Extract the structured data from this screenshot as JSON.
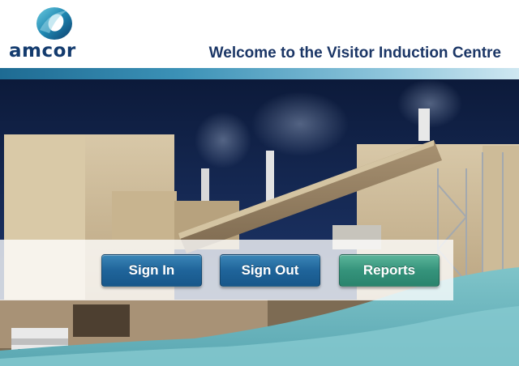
{
  "header": {
    "brand": "amcor",
    "welcome_text": "Welcome to the Visitor Induction Centre"
  },
  "actions": {
    "sign_in": "Sign In",
    "sign_out": "Sign Out",
    "reports": "Reports"
  },
  "colors": {
    "brand_navy": "#1b3666",
    "button_blue": "#1f649a",
    "button_green": "#35937b"
  },
  "icons": {
    "logo": "amcor-logo-icon"
  }
}
